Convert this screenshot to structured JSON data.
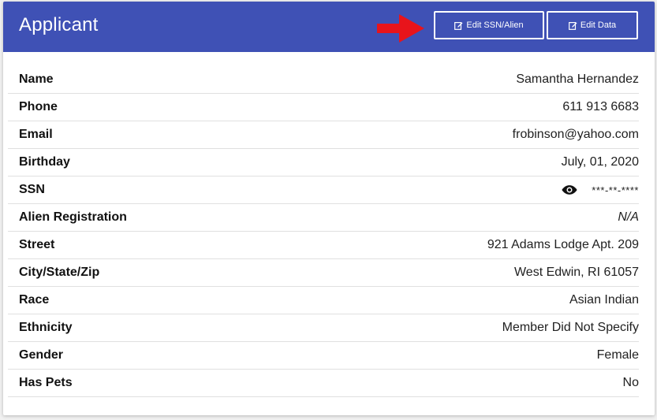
{
  "header": {
    "title": "Applicant",
    "edit_ssn_label": "Edit SSN/Alien",
    "edit_data_label": "Edit Data",
    "color": "#3f51b5"
  },
  "rows": [
    {
      "label": "Name",
      "value": "Samantha Hernandez"
    },
    {
      "label": "Phone",
      "value": "611 913 6683"
    },
    {
      "label": "Email",
      "value": "frobinson@yahoo.com"
    },
    {
      "label": "Birthday",
      "value": "July, 01, 2020"
    },
    {
      "label": "SSN",
      "value": "***-**-****"
    },
    {
      "label": "Alien Registration",
      "value": "N/A"
    },
    {
      "label": "Street",
      "value": "921 Adams Lodge Apt. 209"
    },
    {
      "label": "City/State/Zip",
      "value": "West Edwin, RI 61057"
    },
    {
      "label": "Race",
      "value": "Asian Indian"
    },
    {
      "label": "Ethnicity",
      "value": "Member Did Not Specify"
    },
    {
      "label": "Gender",
      "value": "Female"
    },
    {
      "label": "Has Pets",
      "value": "No"
    }
  ],
  "icons": {
    "edit": "edit-icon",
    "eye": "eye-icon",
    "arrow": "arrow-right-icon"
  },
  "arrow_color": "#e8141b"
}
